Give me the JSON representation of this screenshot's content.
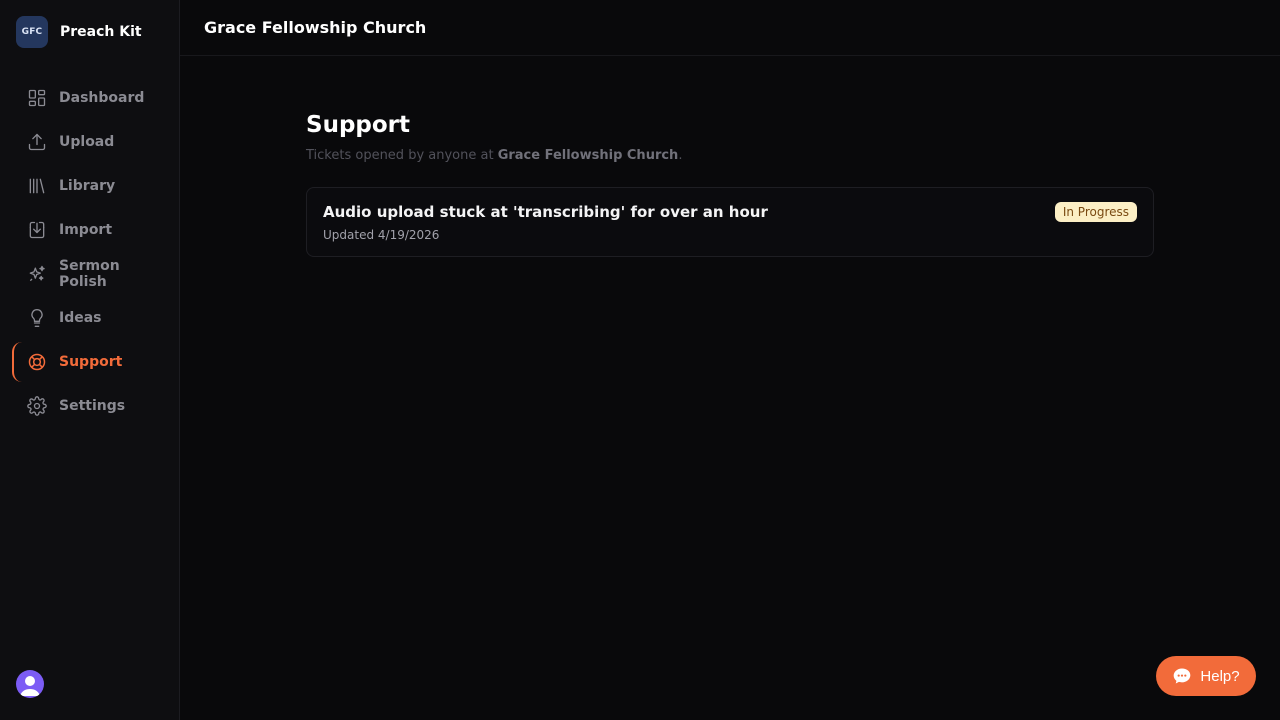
{
  "brand": {
    "logo_text": "GFC",
    "name": "Preach Kit"
  },
  "sidebar": {
    "items": [
      {
        "label": "Dashboard",
        "icon": "dashboard-icon"
      },
      {
        "label": "Upload",
        "icon": "upload-icon"
      },
      {
        "label": "Library",
        "icon": "library-icon"
      },
      {
        "label": "Import",
        "icon": "import-icon"
      },
      {
        "label": "Sermon Polish",
        "icon": "sparkles-icon"
      },
      {
        "label": "Ideas",
        "icon": "lightbulb-icon"
      },
      {
        "label": "Support",
        "icon": "lifebuoy-icon",
        "active": true
      },
      {
        "label": "Settings",
        "icon": "gear-icon"
      }
    ]
  },
  "header": {
    "org_name": "Grace Fellowship Church"
  },
  "main": {
    "title": "Support",
    "subtitle_prefix": "Tickets opened by anyone at ",
    "subtitle_org": "Grace Fellowship Church",
    "subtitle_suffix": ".",
    "tickets": [
      {
        "title": "Audio upload stuck at 'transcribing' for over an hour",
        "updated": "Updated 4/19/2026",
        "status": "In Progress"
      }
    ]
  },
  "help_button": {
    "label": "Help?"
  },
  "colors": {
    "accent": "#f26b3a",
    "background": "#09090b",
    "sidebar": "#0e0e11",
    "badge_bg": "#fcefc5",
    "avatar": "#7c5cf5"
  }
}
